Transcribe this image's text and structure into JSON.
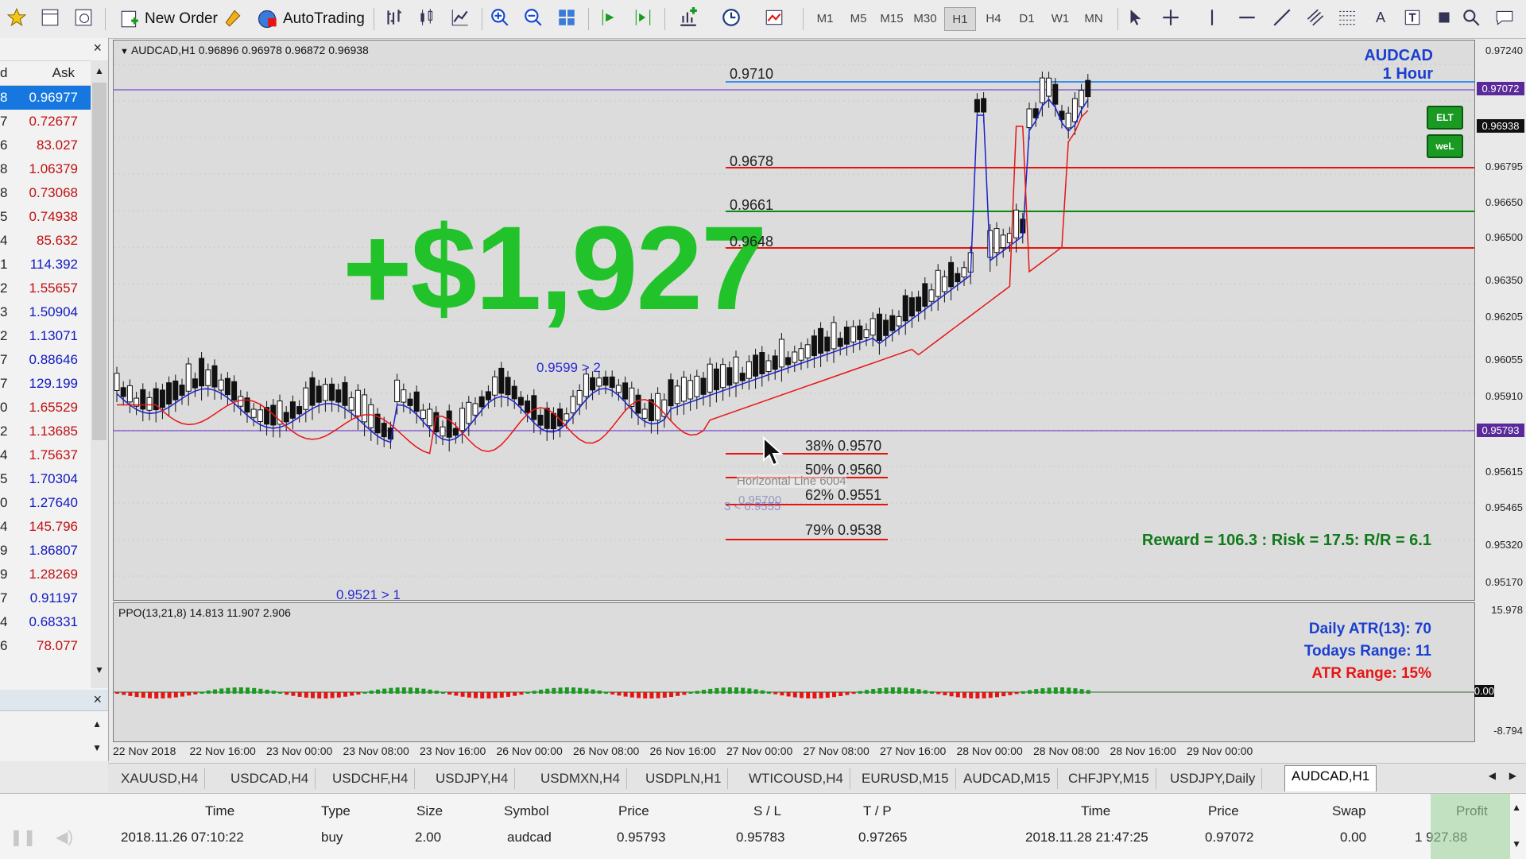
{
  "toolbar": {
    "new_order_label": "New Order",
    "autotrading_label": "AutoTrading",
    "timeframes": [
      "M1",
      "M5",
      "M15",
      "M30",
      "H1",
      "H4",
      "D1",
      "W1",
      "MN"
    ],
    "active_timeframe": "H1"
  },
  "market_watch": {
    "close": "×",
    "col_bid": "d",
    "col_ask": "Ask",
    "rows": [
      {
        "bid": "8",
        "ask": "0.96977",
        "color": "blue"
      },
      {
        "bid": "7",
        "ask": "0.72677",
        "color": "red"
      },
      {
        "bid": "6",
        "ask": "83.027",
        "color": "red"
      },
      {
        "bid": "8",
        "ask": "1.06379",
        "color": "red"
      },
      {
        "bid": "8",
        "ask": "0.73068",
        "color": "red"
      },
      {
        "bid": "5",
        "ask": "0.74938",
        "color": "red"
      },
      {
        "bid": "4",
        "ask": "85.632",
        "color": "red"
      },
      {
        "bid": "1",
        "ask": "114.392",
        "color": "blue"
      },
      {
        "bid": "2",
        "ask": "1.55657",
        "color": "red"
      },
      {
        "bid": "3",
        "ask": "1.50904",
        "color": "blue"
      },
      {
        "bid": "2",
        "ask": "1.13071",
        "color": "blue"
      },
      {
        "bid": "7",
        "ask": "0.88646",
        "color": "blue"
      },
      {
        "bid": "7",
        "ask": "129.199",
        "color": "blue"
      },
      {
        "bid": "0",
        "ask": "1.65529",
        "color": "red"
      },
      {
        "bid": "2",
        "ask": "1.13685",
        "color": "red"
      },
      {
        "bid": "4",
        "ask": "1.75637",
        "color": "red"
      },
      {
        "bid": "5",
        "ask": "1.70304",
        "color": "blue"
      },
      {
        "bid": "0",
        "ask": "1.27640",
        "color": "blue"
      },
      {
        "bid": "4",
        "ask": "145.796",
        "color": "red"
      },
      {
        "bid": "9",
        "ask": "1.86807",
        "color": "blue"
      },
      {
        "bid": "9",
        "ask": "1.28269",
        "color": "red"
      },
      {
        "bid": "7",
        "ask": "0.91197",
        "color": "blue"
      },
      {
        "bid": "4",
        "ask": "0.68331",
        "color": "blue"
      },
      {
        "bid": "6",
        "ask": "78.077",
        "color": "red"
      }
    ]
  },
  "navigator": {
    "close": "×"
  },
  "chart": {
    "info": "AUDCAD,H1  0.96896 0.96978 0.96872 0.96938",
    "symbol": "AUDCAD",
    "timeframe_label": "1 Hour",
    "profit_overlay": "+$1,927",
    "level_labels": [
      "0.9710",
      "0.9678",
      "0.9661",
      "0.9648"
    ],
    "fib_labels": [
      "38% 0.9570",
      "50% 0.9560",
      "62% 0.9551",
      "79% 0.9538"
    ],
    "ghost_line_label": "Horizontal Line 6004",
    "ghost_price": "0.95700",
    "ghost_price2": "3 < 0.9555",
    "swing_labels": [
      "0.9599 > 2",
      "0.9521 > 1"
    ],
    "reward_risk": "Reward = 106.3 : Risk = 17.5: R/R = 6.1",
    "btn_top": "ELT",
    "btn_bottom": "weL",
    "price_scale": [
      "0.97240",
      "0.96938",
      "0.96795",
      "0.96650",
      "0.96500",
      "0.96350",
      "0.96205",
      "0.96055",
      "0.95910",
      "0.95760",
      "0.95615",
      "0.95465",
      "0.95320",
      "0.95170"
    ],
    "price_tag_top": "0.97072",
    "price_tag_cur": "0.96938",
    "price_tag_entry": "0.95793",
    "colors": {
      "green_text": "#22c32a",
      "level_red": "#e8140a",
      "level_green": "#0a8a10",
      "level_blue": "#3a8ee8",
      "ma_blue": "#1a22cc",
      "ma_red": "#e81414"
    }
  },
  "indicator": {
    "title": "PPO(13,21,8) 14.813 11.907 2.906",
    "scale": [
      "15.978",
      "0.00",
      "-8.794"
    ],
    "atr_daily": "Daily ATR(13): 70",
    "todays_range": "Todays Range: 11",
    "atr_range": "ATR Range: 15%"
  },
  "date_scale": [
    "22 Nov 2018",
    "22 Nov 16:00",
    "23 Nov 00:00",
    "23 Nov 08:00",
    "23 Nov 16:00",
    "26 Nov 00:00",
    "26 Nov 08:00",
    "26 Nov 16:00",
    "27 Nov 00:00",
    "27 Nov 08:00",
    "27 Nov 16:00",
    "28 Nov 00:00",
    "28 Nov 08:00",
    "28 Nov 16:00",
    "29 Nov 00:00"
  ],
  "tabs": [
    "XAUUSD,H4",
    "USDCAD,H4",
    "USDCHF,H4",
    "USDJPY,H4",
    "USDMXN,H4",
    "USDPLN,H1",
    "WTICOUSD,H4",
    "EURUSD,M15",
    "AUDCAD,M15",
    "CHFJPY,M15",
    "USDJPY,Daily",
    "AUDCAD,H1"
  ],
  "active_tab": "AUDCAD,H1",
  "terminal": {
    "headers": [
      "Time",
      "Type",
      "Size",
      "Symbol",
      "Price",
      "S / L",
      "T / P",
      "Time",
      "Price",
      "Swap",
      "Profit"
    ],
    "row": [
      "2018.11.26 07:10:22",
      "buy",
      "2.00",
      "audcad",
      "0.95793",
      "0.95783",
      "0.97265",
      "2018.11.28 21:47:25",
      "0.97072",
      "0.00",
      "1 927.88"
    ]
  }
}
